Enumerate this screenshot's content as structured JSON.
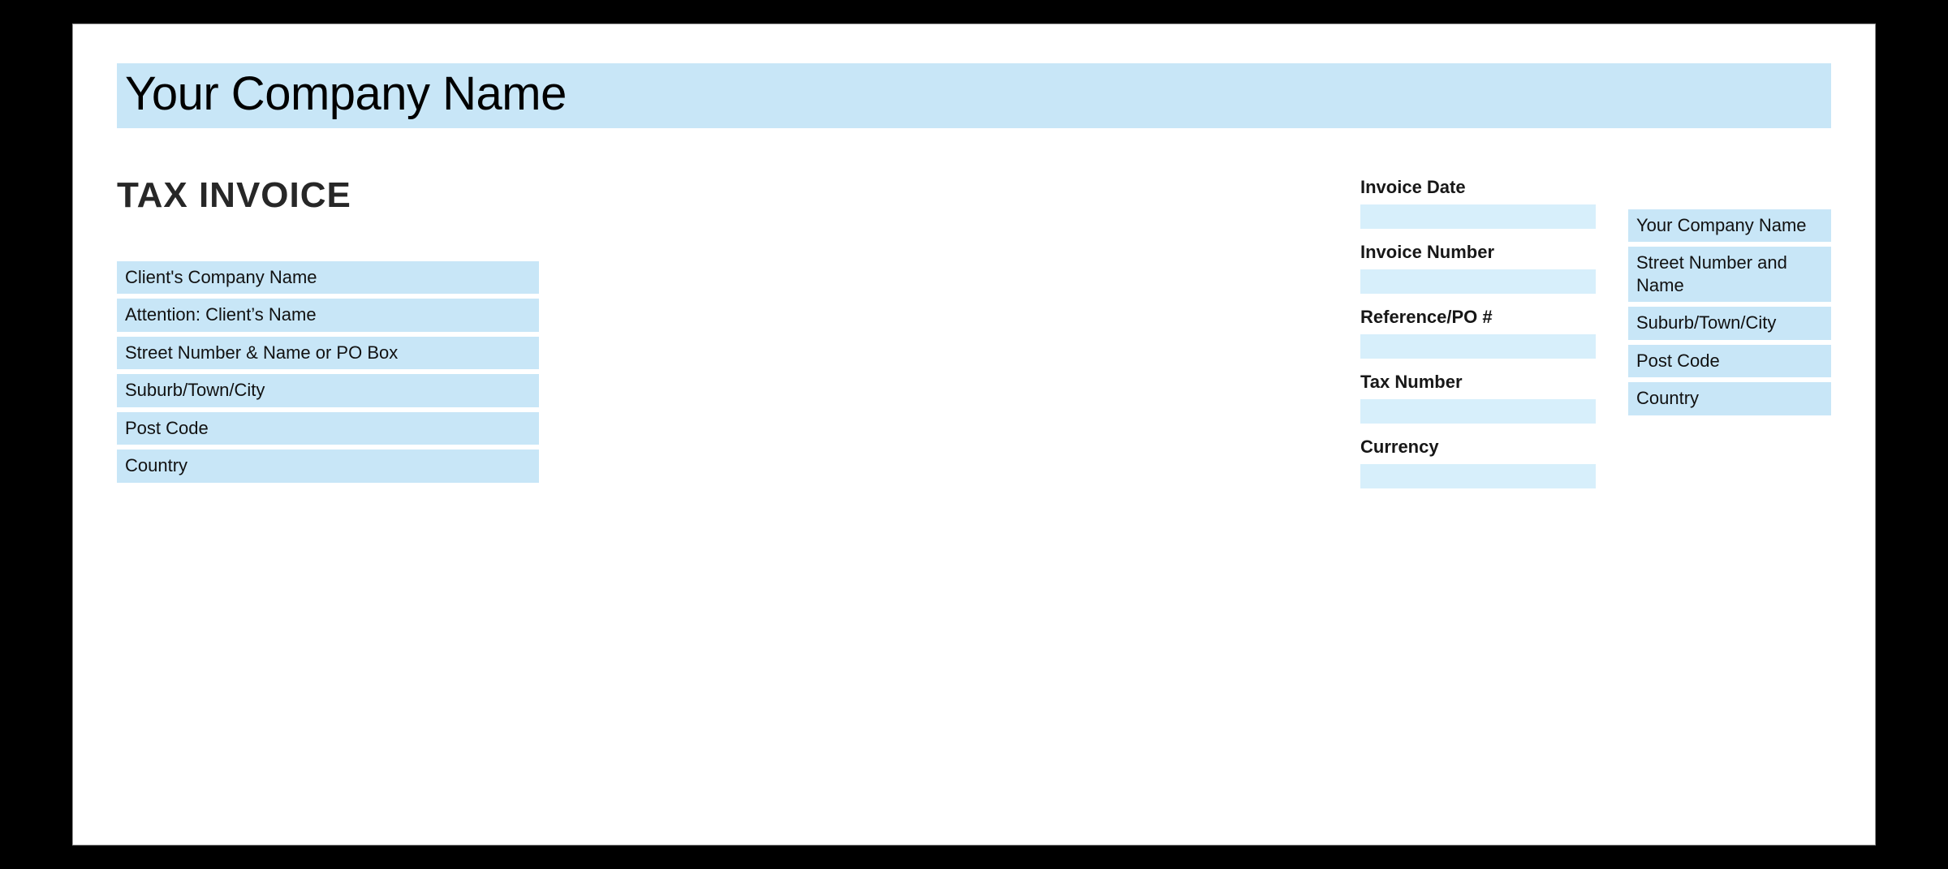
{
  "header": {
    "company_name": "Your Company Name"
  },
  "document": {
    "title": "TAX INVOICE"
  },
  "client": {
    "company": "Client's Company Name",
    "attention": "Attention: Client’s Name",
    "street": "Street Number & Name or PO Box",
    "suburb": "Suburb/Town/City",
    "postcode": "Post Code",
    "country": "Country"
  },
  "meta": {
    "invoice_date_label": "Invoice Date",
    "invoice_date_value": "",
    "invoice_number_label": "Invoice Number",
    "invoice_number_value": "",
    "reference_label": "Reference/PO #",
    "reference_value": "",
    "tax_number_label": "Tax Number",
    "tax_number_value": "",
    "currency_label": "Currency",
    "currency_value": ""
  },
  "sender": {
    "company": "Your Company Name",
    "street": "Street Number and Name",
    "suburb": "Suburb/Town/City",
    "postcode": "Post Code",
    "country": "Country"
  }
}
